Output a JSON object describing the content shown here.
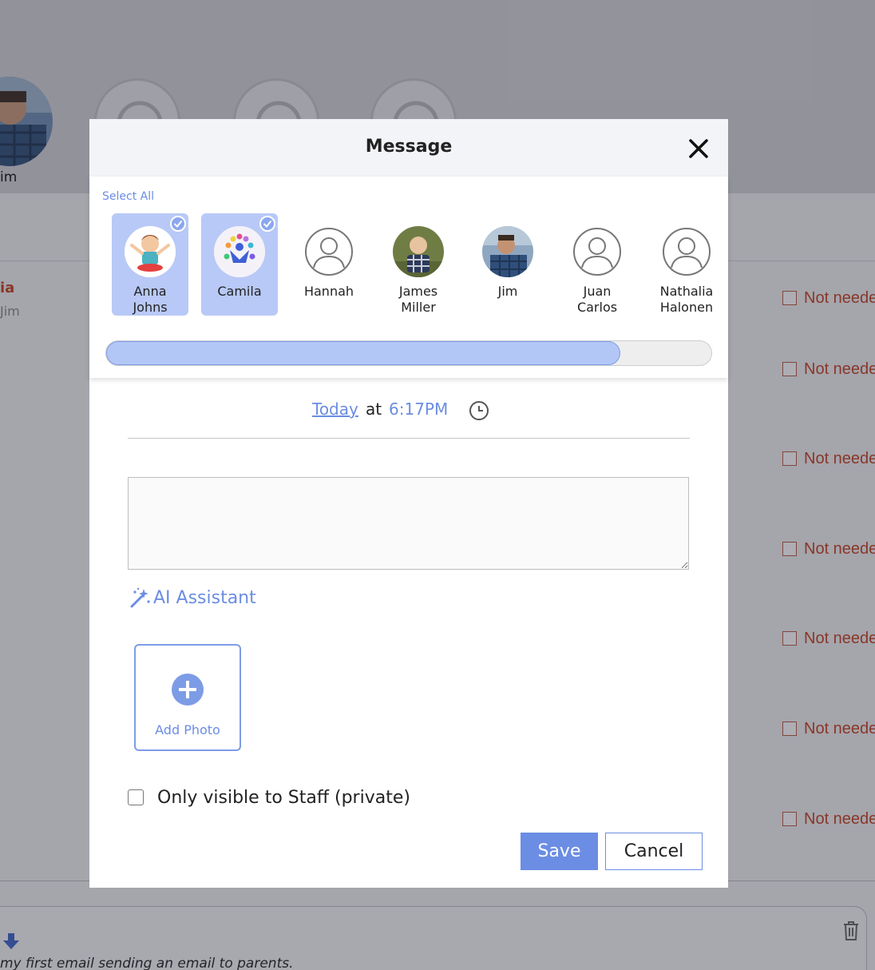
{
  "background": {
    "visible_name": "im",
    "child_name": "ia",
    "child_sub": "Jim",
    "row_label": "Not neede",
    "email_text": "my first email sending an email to parents."
  },
  "modal": {
    "title": "Message",
    "select_all": "Select All",
    "recipients": [
      {
        "line1": "Anna",
        "line2": "Johns",
        "selected": true
      },
      {
        "line1": "Camila",
        "line2": "",
        "selected": true
      },
      {
        "line1": "Hannah",
        "line2": "",
        "selected": false
      },
      {
        "line1": "James",
        "line2": "Miller",
        "selected": false
      },
      {
        "line1": "Jim",
        "line2": "",
        "selected": false
      },
      {
        "line1": "Juan",
        "line2": "Carlos",
        "selected": false
      },
      {
        "line1": "Nathalia",
        "line2": "Halonen",
        "selected": false
      }
    ],
    "scroll_position": 0.85,
    "date_label": "Today",
    "at_label": "at",
    "time_label": "6:17PM",
    "message_value": "",
    "ai_label": "AI Assistant",
    "add_photo_label": "Add Photo",
    "private_label": "Only visible to Staff (private)",
    "private_checked": false,
    "save_label": "Save",
    "cancel_label": "Cancel"
  },
  "colors": {
    "accent": "#6b8de3",
    "selected_bg": "#b8c9f7",
    "warning_text": "#c5421f"
  }
}
